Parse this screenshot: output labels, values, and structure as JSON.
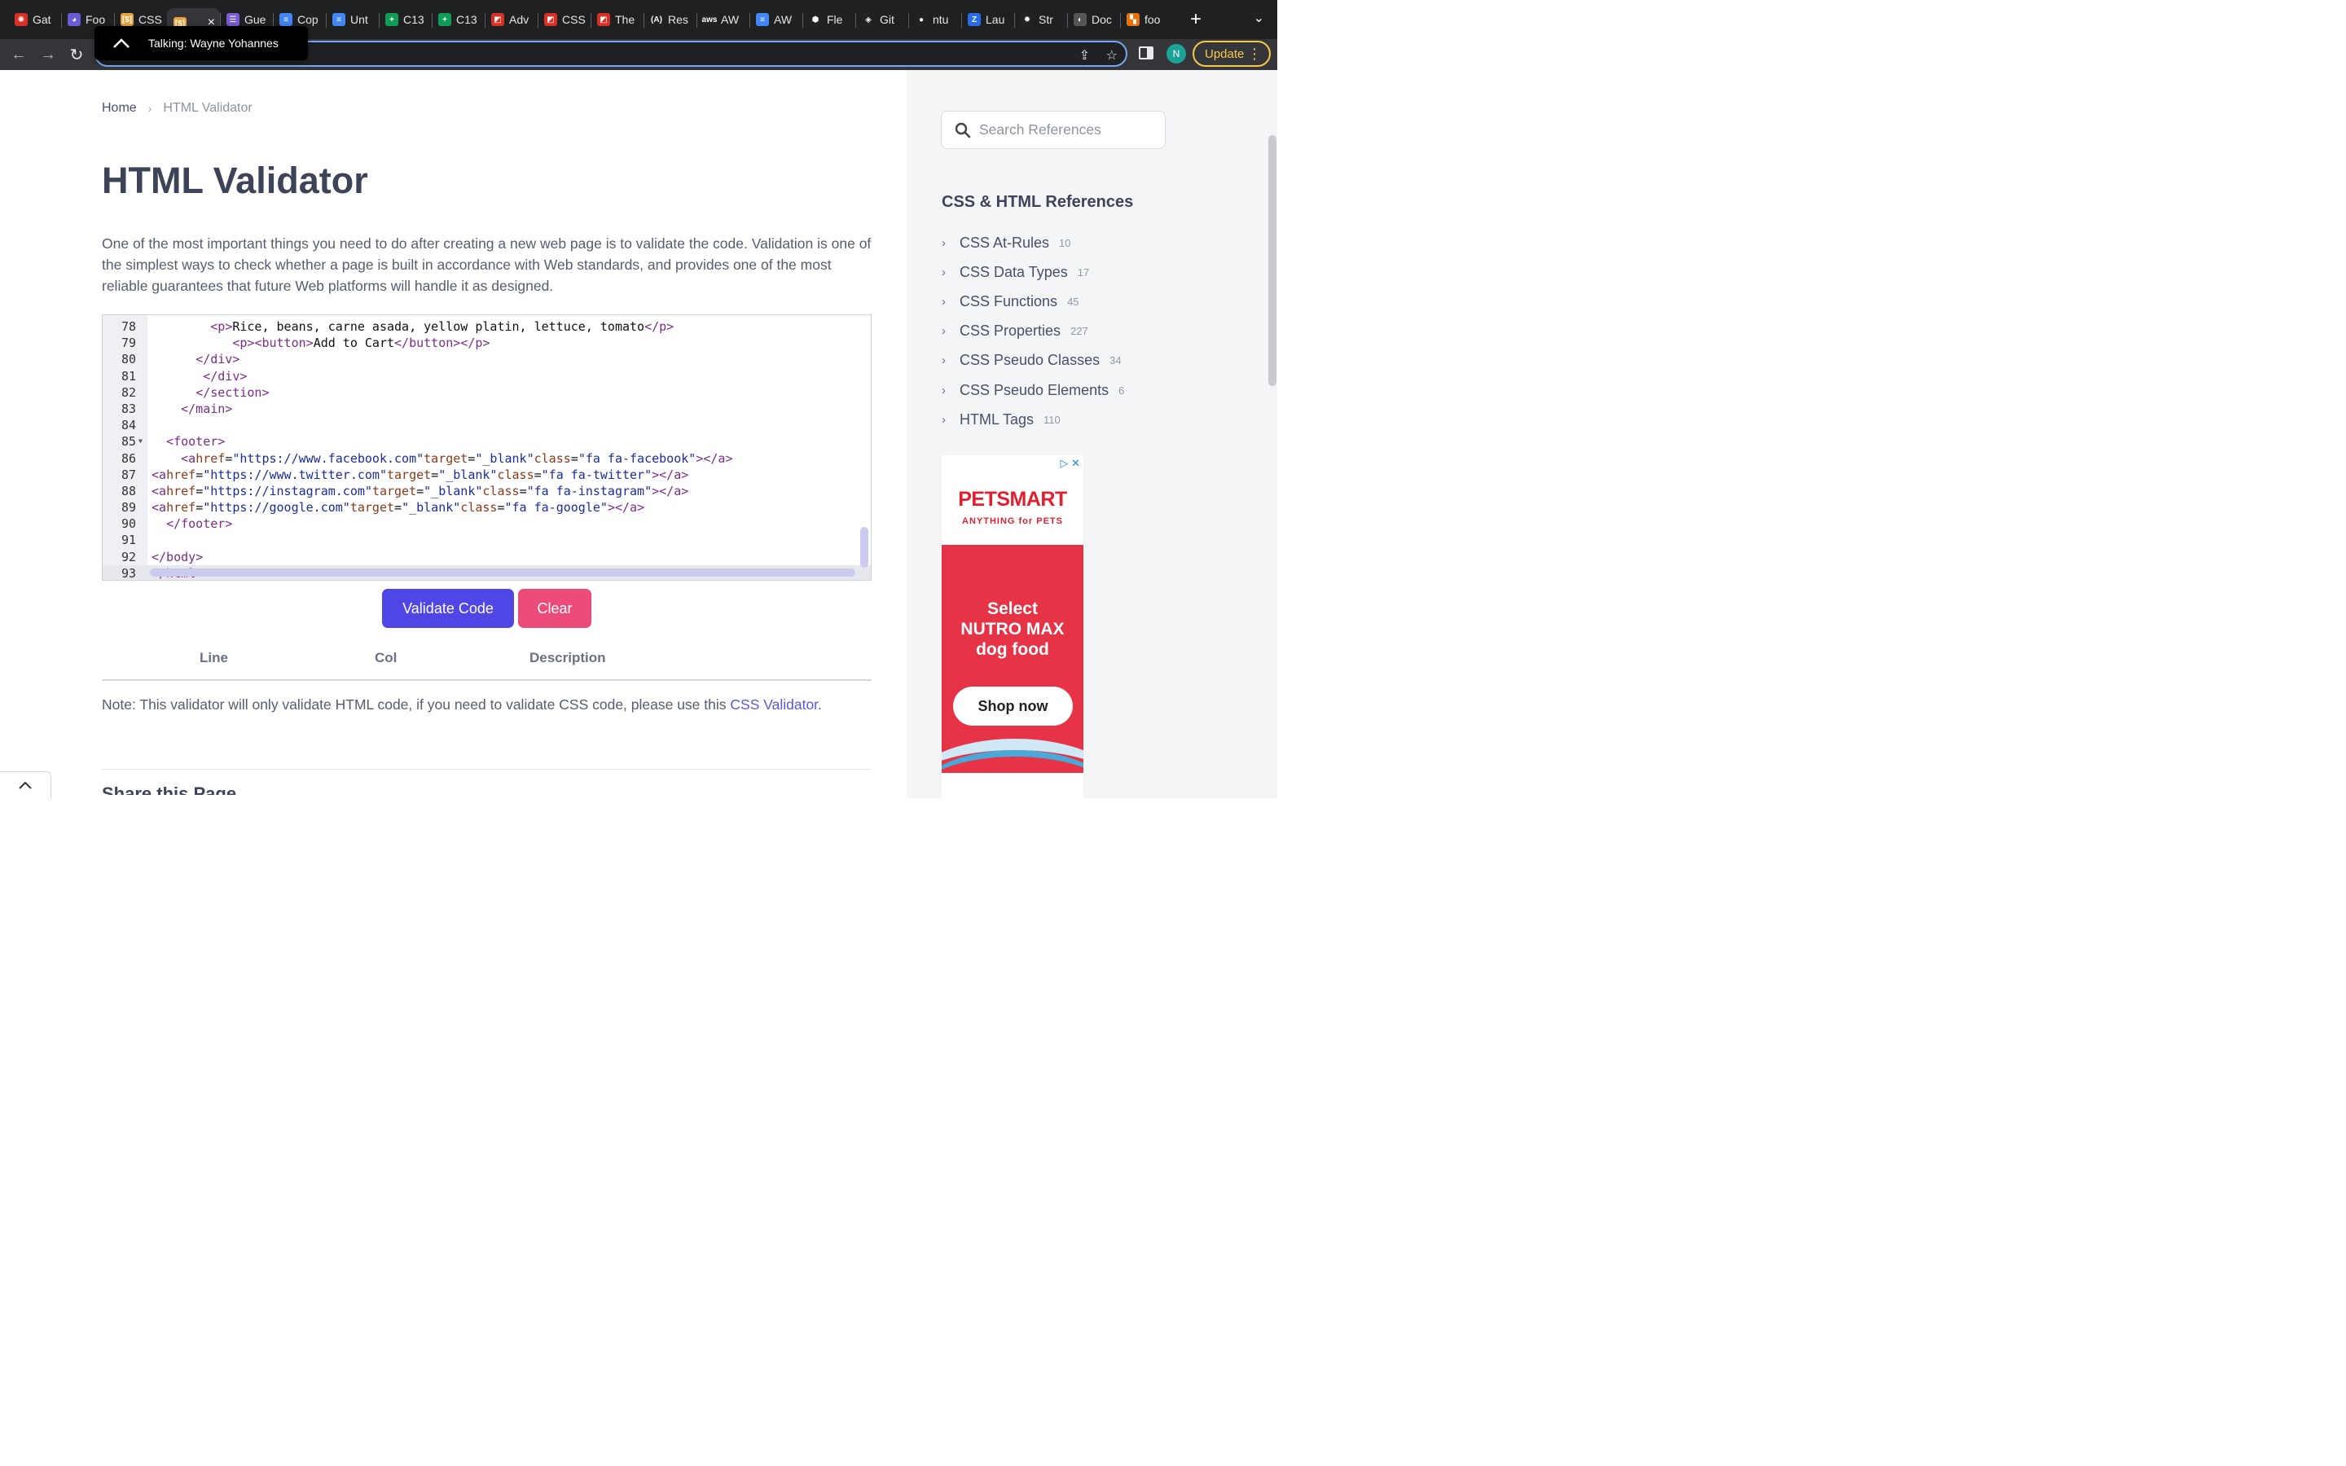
{
  "browser": {
    "tabs": [
      {
        "title": "Gat",
        "color": "#d93025",
        "glyph": "✺"
      },
      {
        "title": "Foo",
        "color": "#6b5bd6",
        "glyph": "◕"
      },
      {
        "title": "CSS",
        "color": "#e8a33d",
        "glyph": "[$]"
      },
      {
        "title": "",
        "color": "#e8a33d",
        "glyph": "[$]",
        "active": true
      },
      {
        "title": "Gue",
        "color": "#7b5cd6",
        "glyph": "☰"
      },
      {
        "title": "Cop",
        "color": "#4285f4",
        "glyph": "≡"
      },
      {
        "title": "Unt",
        "color": "#4285f4",
        "glyph": "≡"
      },
      {
        "title": "C13",
        "color": "#0f9d58",
        "glyph": "+"
      },
      {
        "title": "C13",
        "color": "#0f9d58",
        "glyph": "+"
      },
      {
        "title": "Adv",
        "color": "#d93025",
        "glyph": "◩"
      },
      {
        "title": "CSS",
        "color": "#d93025",
        "glyph": "◩"
      },
      {
        "title": "The",
        "color": "#d93025",
        "glyph": "◩"
      },
      {
        "title": "Res",
        "color": "#222222",
        "glyph": "(A)"
      },
      {
        "title": "AW",
        "color": "#222222",
        "glyph": "aws"
      },
      {
        "title": "AW",
        "color": "#4285f4",
        "glyph": "≡"
      },
      {
        "title": "Fle",
        "color": "#222222",
        "glyph": "⬢"
      },
      {
        "title": "Git",
        "color": "#222222",
        "glyph": "◈"
      },
      {
        "title": "ntu",
        "color": "#222222",
        "glyph": "●"
      },
      {
        "title": "Lau",
        "color": "#2b6de8",
        "glyph": "Z"
      },
      {
        "title": "Str",
        "color": "#222222",
        "glyph": "✹"
      },
      {
        "title": "Doc",
        "color": "#555555",
        "glyph": "◐"
      },
      {
        "title": "foo",
        "color": "#e8710a",
        "glyph": "▚"
      }
    ],
    "new_tab_label": "+",
    "profile_initial": "N",
    "update_label": "Update",
    "talking_text": "Talking: Wayne Yohannes"
  },
  "breadcrumb": {
    "home": "Home",
    "current": "HTML Validator"
  },
  "page": {
    "title": "HTML Validator",
    "intro": "One of the most important things you need to do after creating a new web page is to validate the code. Validation is one of the simplest ways to check whether a page is built in accordance with Web standards, and provides one of the most reliable guarantees that future Web platforms will handle it as designed."
  },
  "editor": {
    "lines": [
      {
        "n": "78",
        "code": "        <p>Rice, beans, carne asada, yellow platin, lettuce, tomato</p>"
      },
      {
        "n": "79",
        "code": "           <p><button>Add to Cart</button></p>"
      },
      {
        "n": "80",
        "code": "      </div>"
      },
      {
        "n": "81",
        "code": "       </div>"
      },
      {
        "n": "82",
        "code": "      </section>"
      },
      {
        "n": "83",
        "code": "    </main>"
      },
      {
        "n": "84",
        "code": ""
      },
      {
        "n": "85",
        "code": "  <footer>",
        "fold": true
      },
      {
        "n": "86",
        "code": "    <a href=\"https://www.facebook.com\" target=\"_blank\" class=\"fa fa-facebook\"></a>"
      },
      {
        "n": "87",
        "code": "<a href=\"https://www.twitter.com\" target=\"_blank\" class=\"fa fa-twitter\"></a>"
      },
      {
        "n": "88",
        "code": "<a href=\"https://instagram.com\" target=\"_blank\" class=\"fa fa-instagram\"></a>"
      },
      {
        "n": "89",
        "code": "<a href=\"https://google.com\" target=\"_blank\" class=\"fa fa-google\"></a>"
      },
      {
        "n": "90",
        "code": "  </footer>"
      },
      {
        "n": "91",
        "code": ""
      },
      {
        "n": "92",
        "code": "</body>"
      },
      {
        "n": "93",
        "code": "</html>",
        "current": true
      }
    ]
  },
  "buttons": {
    "validate": "Validate Code",
    "clear": "Clear"
  },
  "results": {
    "col_line": "Line",
    "col_col": "Col",
    "col_desc": "Description"
  },
  "note": {
    "text": "Note: This validator will only validate HTML code, if you need to validate CSS code, please use this ",
    "link": "CSS Validator",
    "end": "."
  },
  "share_title": "Share this Page",
  "sidebar": {
    "search_placeholder": "Search References",
    "heading": "CSS & HTML References",
    "items": [
      {
        "label": "CSS At-Rules",
        "count": "10"
      },
      {
        "label": "CSS Data Types",
        "count": "17"
      },
      {
        "label": "CSS Functions",
        "count": "45"
      },
      {
        "label": "CSS Properties",
        "count": "227"
      },
      {
        "label": "CSS Pseudo Classes",
        "count": "34"
      },
      {
        "label": "CSS Pseudo Elements",
        "count": "6"
      },
      {
        "label": "HTML Tags",
        "count": "110"
      }
    ]
  },
  "ad": {
    "brand": "PETSMART",
    "tagline": "ANYTHING for PETS",
    "headline_1": "Select",
    "headline_2": "NUTRO MAX",
    "headline_3": "dog food",
    "cta": "Shop now"
  },
  "colors": {
    "accent": "#5046e5",
    "danger": "#ed4b79",
    "link": "#5a58d6",
    "update": "#f7c948"
  }
}
